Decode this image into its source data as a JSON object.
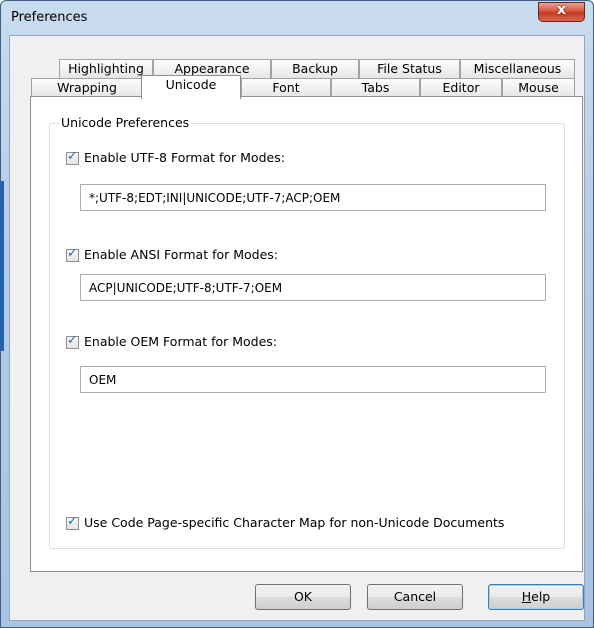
{
  "window": {
    "title": "Preferences",
    "close_glyph": "x"
  },
  "tabs_row1": [
    "Highlighting",
    "Appearance",
    "Backup",
    "File Status",
    "Miscellaneous"
  ],
  "tabs_row2": [
    "Wrapping",
    "Unicode",
    "Font",
    "Tabs",
    "Editor",
    "Mouse"
  ],
  "active_tab": "Unicode",
  "group": {
    "label": "Unicode Preferences",
    "utf8": {
      "label": "Enable UTF-8 Format for Modes:",
      "checked": true,
      "value": "*;UTF-8;EDT;INI|UNICODE;UTF-7;ACP;OEM"
    },
    "ansi": {
      "label": "Enable ANSI Format for Modes:",
      "checked": true,
      "value": "ACP|UNICODE;UTF-8;UTF-7;OEM"
    },
    "oem": {
      "label": "Enable OEM Format for Modes:",
      "checked": true,
      "value": "OEM"
    },
    "codepage": {
      "label": "Use Code Page-specific Character Map for non-Unicode Documents",
      "checked": true
    }
  },
  "buttons": {
    "ok": "OK",
    "cancel": "Cancel",
    "help_first": "H",
    "help_rest": "elp"
  },
  "colors": {
    "accent": "#1b62b8",
    "close": "#c23a22",
    "check": "#2a6ab3"
  }
}
